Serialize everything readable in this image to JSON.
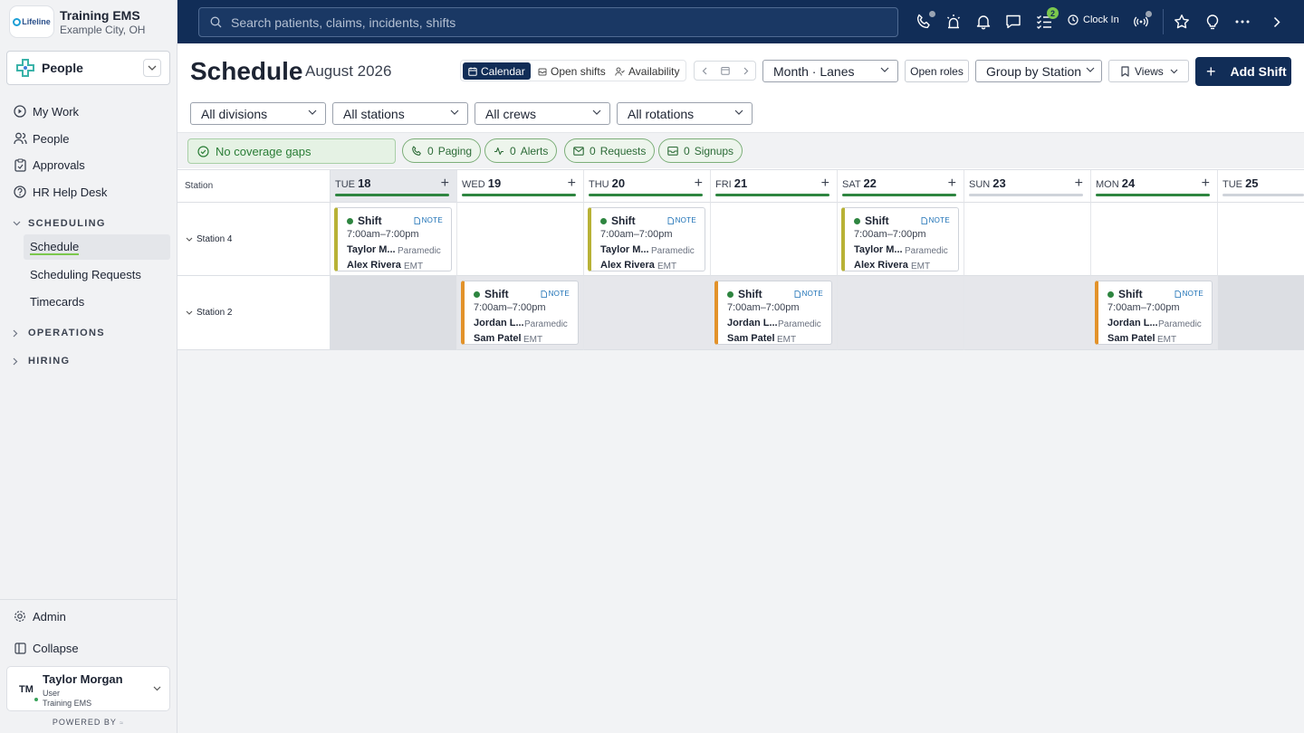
{
  "org": {
    "logo_text": "Lifeline",
    "name": "Training EMS",
    "city": "Example City, OH"
  },
  "app_switcher": {
    "label": "People"
  },
  "nav": {
    "items": [
      {
        "label": "My Work",
        "icon": "play-circle-icon"
      },
      {
        "label": "People",
        "icon": "people-icon"
      },
      {
        "label": "Approvals",
        "icon": "clipboard-icon"
      },
      {
        "label": "HR Help Desk",
        "icon": "help-circle-icon"
      }
    ],
    "scheduling_label": "SCHEDULING",
    "scheduling_items": [
      "Schedule",
      "Scheduling Requests",
      "Timecards"
    ],
    "operations_label": "OPERATIONS",
    "hiring_label": "HIRING",
    "admin_label": "Admin",
    "collapse_label": "Collapse"
  },
  "user": {
    "initials": "TM",
    "name": "Taylor Morgan",
    "role": "User",
    "org": "Training EMS"
  },
  "powered_by": "POWERED BY",
  "topbar": {
    "search_placeholder": "Search patients, claims, incidents, shifts",
    "tasks_badge": "2",
    "clock_in_label": "Clock In"
  },
  "page": {
    "title": "Schedule",
    "month": "August 2026",
    "view_tabs": [
      "Calendar",
      "Open shifts",
      "Availability"
    ],
    "view_mode": "Month · Lanes",
    "open_roles_label": "Open roles",
    "group_by": "Group by Station",
    "views_label": "Views",
    "add_shift_label": "Add Shift"
  },
  "filters": {
    "divisions": "All divisions",
    "stations": "All stations",
    "crews": "All crews",
    "rotations": "All rotations"
  },
  "coverage": {
    "label": "No coverage gaps"
  },
  "chips": [
    {
      "count": "0",
      "label": "Paging"
    },
    {
      "count": "0",
      "label": "Alerts"
    },
    {
      "count": "0",
      "label": "Requests"
    },
    {
      "count": "0",
      "label": "Signups"
    }
  ],
  "grid": {
    "station_header": "Station",
    "days": [
      {
        "dow": "TUE",
        "num": "18"
      },
      {
        "dow": "WED",
        "num": "19"
      },
      {
        "dow": "THU",
        "num": "20"
      },
      {
        "dow": "FRI",
        "num": "21"
      },
      {
        "dow": "SAT",
        "num": "22"
      },
      {
        "dow": "SUN",
        "num": "23"
      },
      {
        "dow": "MON",
        "num": "24"
      },
      {
        "dow": "TUE",
        "num": "25"
      }
    ],
    "stations": [
      "Station 4",
      "Station 2"
    ],
    "shift_title": "Shift",
    "note_label": "NOTE",
    "shift_time": "7:00am–7:00pm",
    "station4_crew": {
      "p1": "Taylor M...",
      "r1": "Paramedic",
      "p2": "Alex Rivera",
      "r2": "EMT"
    },
    "station2_crew": {
      "p1": "Jordan L...",
      "r1": "Paramedic",
      "p2": "Sam Patel",
      "r2": "EMT"
    }
  },
  "colors": {
    "station4_accent": "#b8b236",
    "station2_accent": "#e2922a",
    "nav_dark": "#112d57",
    "coverage_green": "#2e8540"
  }
}
